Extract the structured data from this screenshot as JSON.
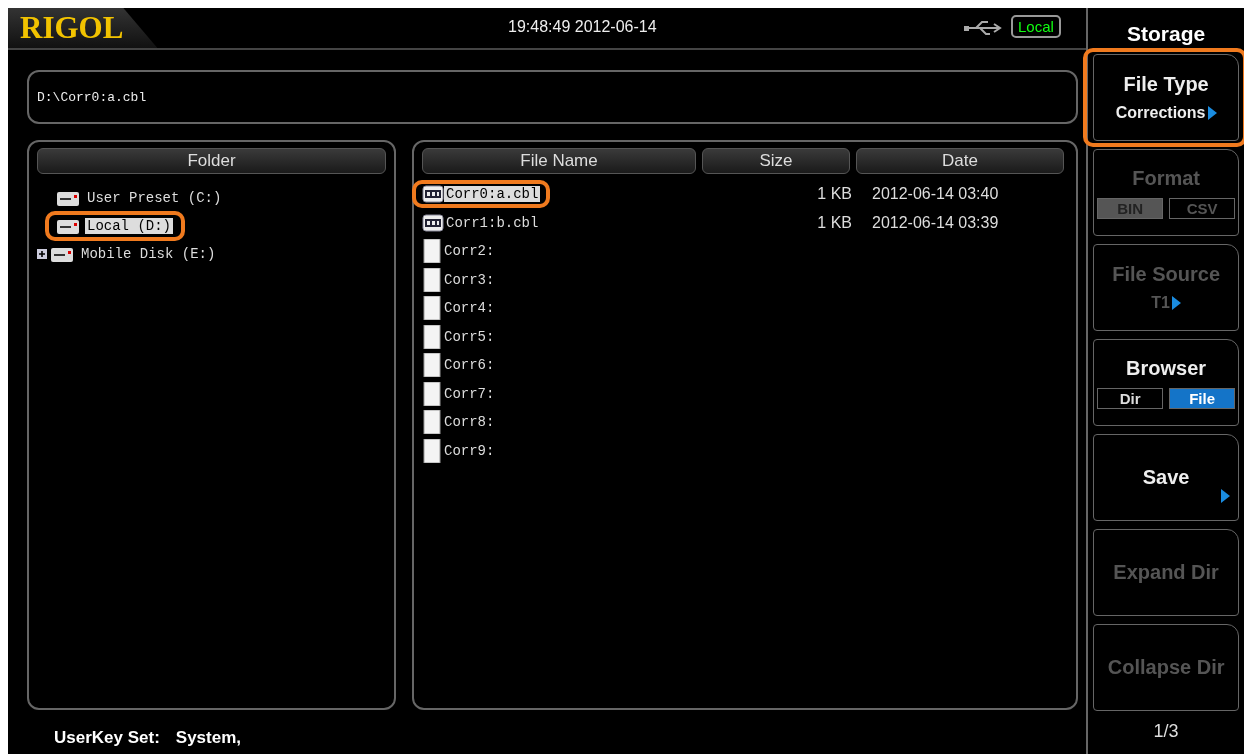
{
  "header": {
    "logo": "RIGOL",
    "datetime": "19:48:49 2012-06-14",
    "storage_badge": "Local"
  },
  "path": "D:\\Corr0:a.cbl",
  "folder_panel": {
    "column": "Folder",
    "items": [
      {
        "label": "User Preset (C:)",
        "selected": false,
        "collapsed": false,
        "highlighted": false
      },
      {
        "label": "Local (D:)",
        "selected": true,
        "collapsed": false,
        "highlighted": true
      },
      {
        "label": "Mobile Disk (E:)",
        "selected": false,
        "collapsed": true,
        "highlighted": false
      }
    ]
  },
  "file_panel": {
    "columns": [
      "File Name",
      "Size",
      "Date"
    ],
    "rows": [
      {
        "kind": "cbl",
        "name": "Corr0:a.cbl",
        "size": "1 KB",
        "date": "2012-06-14 03:40",
        "selected": true,
        "highlighted": true
      },
      {
        "kind": "cbl",
        "name": "Corr1:b.cbl",
        "size": "1 KB",
        "date": "2012-06-14 03:39",
        "selected": false,
        "highlighted": false
      },
      {
        "kind": "blank",
        "name": "Corr2:",
        "selected": false,
        "highlighted": false
      },
      {
        "kind": "blank",
        "name": "Corr3:",
        "selected": false,
        "highlighted": false
      },
      {
        "kind": "blank",
        "name": "Corr4:",
        "selected": false,
        "highlighted": false
      },
      {
        "kind": "blank",
        "name": "Corr5:",
        "selected": false,
        "highlighted": false
      },
      {
        "kind": "blank",
        "name": "Corr6:",
        "selected": false,
        "highlighted": false
      },
      {
        "kind": "blank",
        "name": "Corr7:",
        "selected": false,
        "highlighted": false
      },
      {
        "kind": "blank",
        "name": "Corr8:",
        "selected": false,
        "highlighted": false
      },
      {
        "kind": "blank",
        "name": "Corr9:",
        "selected": false,
        "highlighted": false
      }
    ]
  },
  "status_bar": {
    "label": "UserKey Set:",
    "value": "System,"
  },
  "menu": {
    "title": "Storage",
    "page": "1/3",
    "keys": [
      {
        "kind": "value",
        "label": "File Type",
        "value": "Corrections",
        "submenu": true,
        "disabled": false,
        "highlighted": true
      },
      {
        "kind": "toggle",
        "label": "Format",
        "options": [
          {
            "label": "BIN",
            "selected": true
          },
          {
            "label": "CSV",
            "selected": false
          }
        ],
        "disabled": true,
        "highlighted": false
      },
      {
        "kind": "value",
        "label": "File Source",
        "value": "T1",
        "submenu": true,
        "disabled": true,
        "highlighted": false
      },
      {
        "kind": "toggle",
        "label": "Browser",
        "options": [
          {
            "label": "Dir",
            "selected": false
          },
          {
            "label": "File",
            "selected": true
          }
        ],
        "disabled": false,
        "highlighted": false
      },
      {
        "kind": "action",
        "label": "Save",
        "submenu": true,
        "disabled": false,
        "highlighted": false
      },
      {
        "kind": "action",
        "label": "Expand Dir",
        "submenu": false,
        "disabled": true,
        "highlighted": false
      },
      {
        "kind": "action",
        "label": "Collapse Dir",
        "submenu": false,
        "disabled": true,
        "highlighted": false
      }
    ]
  }
}
